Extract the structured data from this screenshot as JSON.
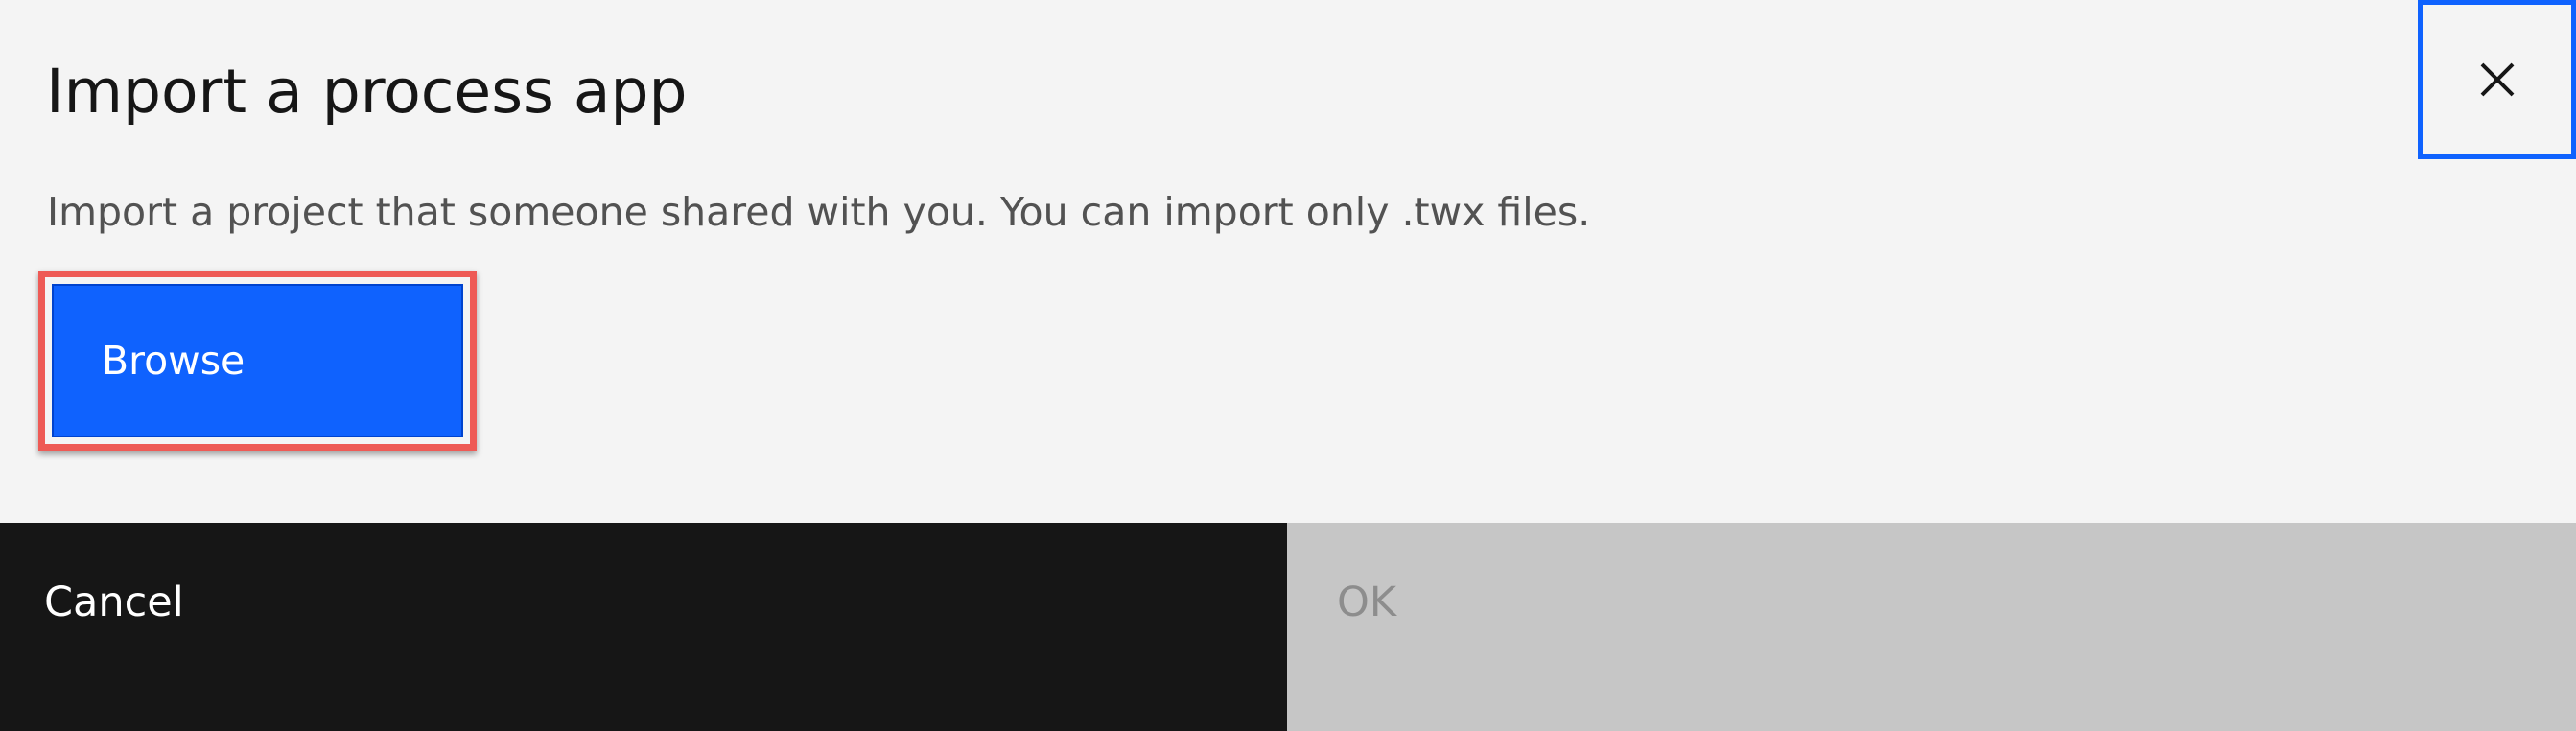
{
  "dialog": {
    "title": "Import a process app",
    "description": "Import a project that someone shared with you. You can import only .twx files.",
    "close_icon": "close-icon",
    "browse_label": "Browse"
  },
  "footer": {
    "cancel_label": "Cancel",
    "ok_label": "OK"
  },
  "colors": {
    "primary": "#0f62fe",
    "highlight": "#ee5a55",
    "secondary_button": "#161616",
    "disabled_button": "#c6c6c6",
    "background": "#f4f4f4"
  }
}
